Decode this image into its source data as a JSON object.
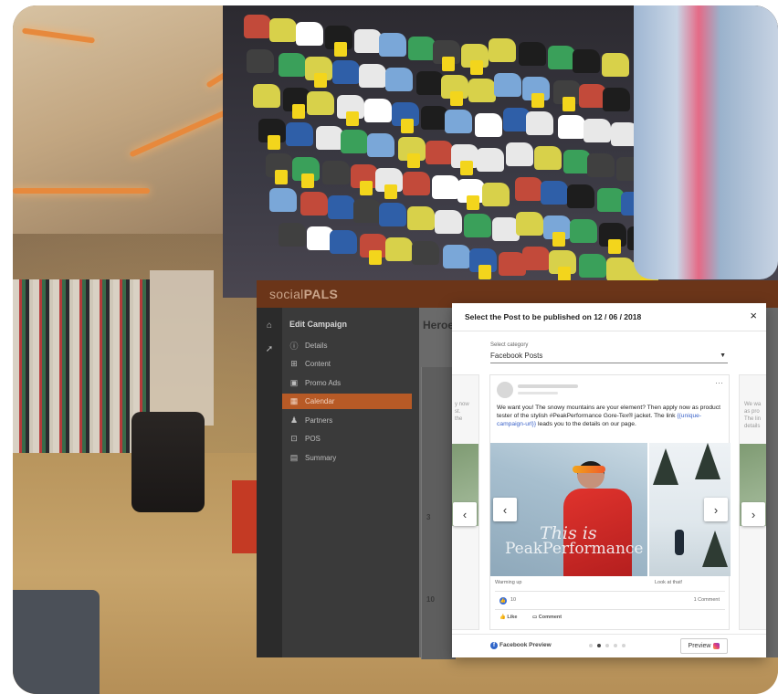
{
  "app": {
    "logo": {
      "prefix": "social",
      "brand": "PALS"
    },
    "sidebar": {
      "title": "Edit Campaign",
      "items": [
        {
          "label": "Details",
          "icon": "info-icon"
        },
        {
          "label": "Content",
          "icon": "plus-square-icon"
        },
        {
          "label": "Promo Ads",
          "icon": "ad-icon"
        },
        {
          "label": "Calendar",
          "icon": "calendar-icon",
          "active": true
        },
        {
          "label": "Partners",
          "icon": "user-plus-icon"
        },
        {
          "label": "POS",
          "icon": "cart-icon"
        },
        {
          "label": "Summary",
          "icon": "clipboard-icon"
        }
      ]
    },
    "content": {
      "title": "Heroe",
      "calendar_days": [
        "3",
        "10"
      ]
    }
  },
  "modal": {
    "title": "Select the Post to be published on 12 / 06 / 2018",
    "close_label": "×",
    "select_label": "Select category",
    "select_value": "Facebook Posts",
    "side_text_left": "y now\nst.\nthe",
    "side_text_right": "We wa\nas pro\nThe lin\ndetails",
    "post": {
      "more_label": "···",
      "text_before": "We want you! The snowy mountains are your element? Then apply now as product tester of the stylish #PeakPerformance Gore-Tex® jacket. The link ",
      "token": "{{unique-campaign-url}}",
      "text_after": " leads you to the details on our page.",
      "image_text_1": "This is",
      "image_text_2": "PeakPerformance",
      "caption_1": "Warming up",
      "caption_2": "Look at that!",
      "likes": "10",
      "comments": "1 Comment",
      "like_action": "Like",
      "comment_action": "Comment"
    },
    "footer": {
      "fb_label": "Facebook Preview",
      "preview_label": "Preview",
      "dots": [
        false,
        true,
        false,
        false,
        false
      ]
    }
  }
}
